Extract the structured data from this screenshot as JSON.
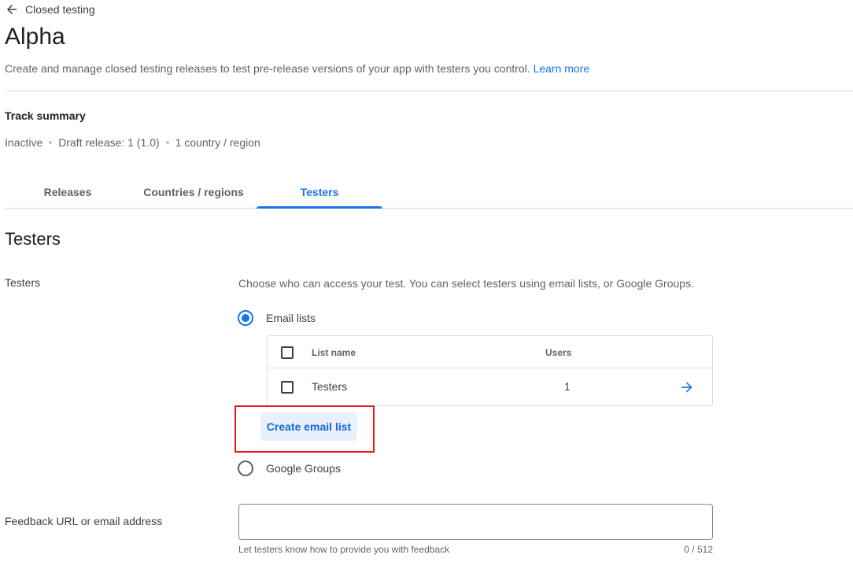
{
  "breadcrumb": {
    "back_label": "Closed testing",
    "icon": "arrow-back-icon"
  },
  "page": {
    "title": "Alpha",
    "description": "Create and manage closed testing releases to test pre-release versions of your app with testers you control.",
    "learn_more": "Learn more"
  },
  "track_summary": {
    "title": "Track summary",
    "status": "Inactive",
    "draft_release": "Draft release: 1 (1.0)",
    "countries": "1 country / region"
  },
  "tabs": [
    {
      "label": "Releases",
      "active": false
    },
    {
      "label": "Countries / regions",
      "active": false
    },
    {
      "label": "Testers",
      "active": true
    }
  ],
  "testers_section": {
    "title": "Testers",
    "label": "Testers",
    "instruction": "Choose who can access your test. You can select testers using email lists, or Google Groups.",
    "options": {
      "email_lists": {
        "label": "Email lists",
        "selected": true
      },
      "google_groups": {
        "label": "Google Groups",
        "selected": false
      }
    },
    "table": {
      "headers": {
        "name": "List name",
        "users": "Users"
      },
      "rows": [
        {
          "name": "Testers",
          "users": "1",
          "checked": false,
          "icon": "arrow-forward-icon"
        }
      ]
    },
    "create_button": "Create email list"
  },
  "feedback": {
    "label": "Feedback URL or email address",
    "value": "",
    "helper": "Let testers know how to provide you with feedback",
    "counter": "0 / 512"
  },
  "colors": {
    "accent": "#1a73e8",
    "highlight_border": "#e31b1b",
    "button_bg": "#e8f0fe",
    "text_secondary": "#5f6368",
    "divider": "#dadce0"
  }
}
